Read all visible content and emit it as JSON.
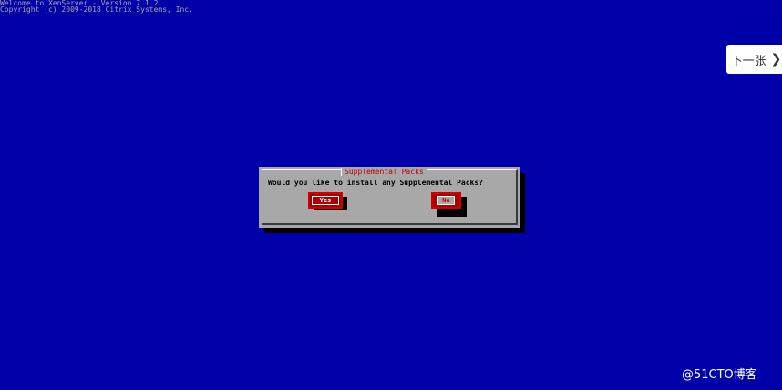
{
  "console": {
    "line1": "Welcome to XenServer - Version 7.1.2",
    "line2": "Copyright (c) 2009-2018 Citrix Systems, Inc."
  },
  "dialog": {
    "title": "Supplemental Packs",
    "message": "Would you like to install any Supplemental Packs?",
    "yes_label": "Yes",
    "no_label": "No"
  },
  "overlay": {
    "next_label": "下一张",
    "next_icon": "chevron-right-icon",
    "watermark": "@51CTO博客"
  },
  "colors": {
    "screen_bg": "#0000A8",
    "dialog_bg": "#A8A8A8",
    "button_bg": "#A80000",
    "title_color": "#C00000"
  }
}
